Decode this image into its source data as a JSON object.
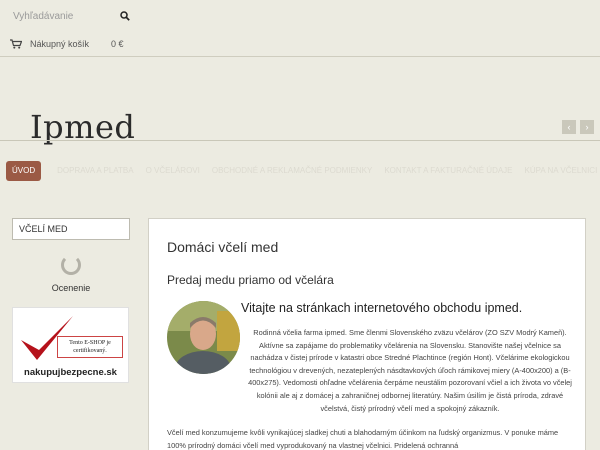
{
  "search": {
    "placeholder": "Vyhľadávanie"
  },
  "cart": {
    "label": "Nákupný košík",
    "amount": "0 €"
  },
  "header": {
    "logo": "Ipmed",
    "prev": "‹",
    "next": "›"
  },
  "nav": {
    "items": [
      "Úvod",
      "Doprava a platba",
      "O včelárovi",
      "Obchodné a reklamačné podmienky",
      "Kontakt a fakturačné údaje",
      "Kúpa na včelnici"
    ]
  },
  "sidebar": {
    "category": "VČELÍ MED",
    "rating_label": "Ocenenie",
    "badge_cert": "Tento E-SHOP je certifikovaný.",
    "badge_site": "nakupujbezpecne.sk"
  },
  "main": {
    "title": "Domáci včelí med",
    "subtitle": "Predaj medu priamo od včelára",
    "welcome_title": "Vitajte na stránkach internetového obchodu ipmed.",
    "welcome_text": "Rodinná včelia farma ipmed. Sme členmi Slovenského zväzu včelárov (ZO SZV Modrý Kameň). Aktívne sa zapájame do problematiky včelárenia na Slovensku. Stanovište našej včelnice sa nachádza v čistej prírode v katastri obce Stredné Plachtince (región Hont). Včelárime ekologickou technológiou v drevených, nezateplených násdtavkových úľoch rámikovej miery (A-400x200) a (B-400x275). Vedomosti ohľadne včelárenia čerpáme neustálim pozorovaní včiel a ich života vo včelej kolónii ale aj z domácej a zahraničnej odbornej literatúry. Našim úsilím je čistá príroda, zdravé včelstvá, čistý prírodný včelí med a spokojný zákazník.",
    "bottom_text": "Včelí med konzumujeme kvôli vynikajúcej sladkej chuti a blahodarným účinkom na ľudský organizmus. V ponuke máme 100% prírodný domáci včelí med vyprodukovaný na vlastnej včelnici. Pridelená ochranná"
  },
  "colors": {
    "nav_active": "#9b5a45",
    "background": "#ecebe1"
  }
}
